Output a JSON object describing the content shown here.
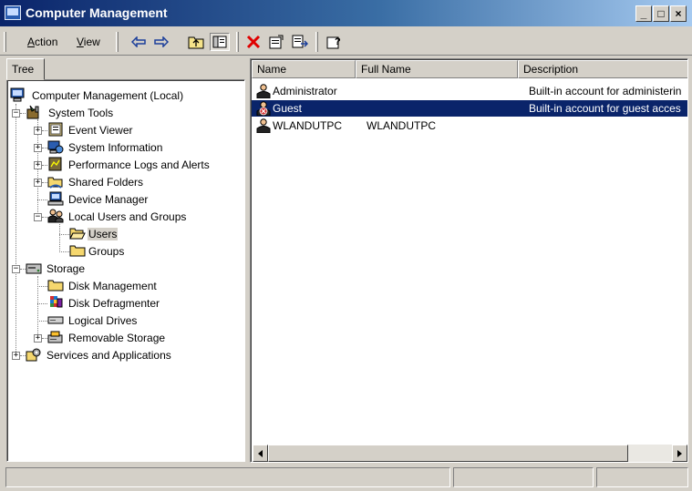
{
  "window": {
    "title": "Computer Management",
    "controls": [
      "_",
      "□",
      "×"
    ]
  },
  "menu": {
    "action_label": "Action",
    "action_hotkey": "A",
    "view_label": "View",
    "view_hotkey": "V"
  },
  "toolbar": {
    "icons": [
      "back-arrow-icon",
      "forward-arrow-icon",
      "up-one-level-icon",
      "show-hide-tree-icon",
      "delete-icon",
      "properties-icon",
      "export-list-icon",
      "help-icon"
    ],
    "colors": {
      "delete": "#e00000",
      "arrow": "#1c3f9a"
    }
  },
  "tree_tab": {
    "label": "Tree"
  },
  "tree": {
    "root": "Computer Management (Local)",
    "system_tools": "System Tools",
    "event_viewer": "Event Viewer",
    "system_information": "System Information",
    "performance_logs": "Performance Logs and Alerts",
    "shared_folders": "Shared Folders",
    "device_manager": "Device Manager",
    "local_users_groups": "Local Users and Groups",
    "users": "Users",
    "groups": "Groups",
    "storage": "Storage",
    "disk_management": "Disk Management",
    "disk_defragmenter": "Disk Defragmenter",
    "logical_drives": "Logical Drives",
    "removable_storage": "Removable Storage",
    "services_apps": "Services and Applications"
  },
  "list": {
    "columns": [
      "Name",
      "Full Name",
      "Description"
    ],
    "rows": [
      {
        "name": "Administrator",
        "full_name": "",
        "description": "Built-in account for administerin"
      },
      {
        "name": "Guest",
        "full_name": "",
        "description": "Built-in account for guest acces"
      },
      {
        "name": "WLANDUTPC",
        "full_name": "WLANDUTPC",
        "description": ""
      }
    ],
    "selected_row": "Guest"
  },
  "colors": {
    "title_gradient_start": "#0a246a",
    "title_gradient_end": "#a6caf0",
    "selection": "#0a246a",
    "chrome": "#d4d0c8"
  }
}
